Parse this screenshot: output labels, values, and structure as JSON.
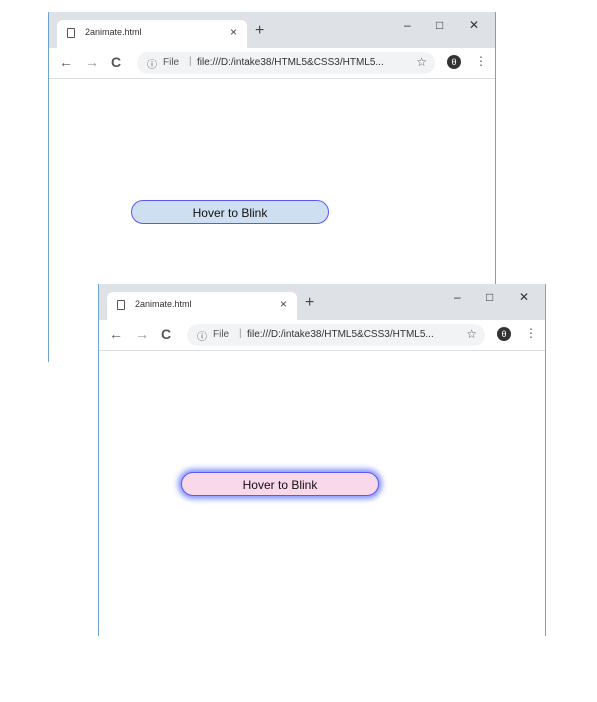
{
  "windows": [
    {
      "tab_title": "2animate.html",
      "tab_close": "×",
      "new_tab": "+",
      "minimize": "–",
      "maximize": "□",
      "close": "✕",
      "back": "←",
      "forward": "→",
      "reload": "C",
      "info_icon": "ⓘ",
      "scheme_label": "File",
      "separator": "|",
      "url": "file:///D:/intake38/HTML5&CSS3/HTML5...",
      "bookmark": "☆",
      "account": "θ",
      "menu": "⋮",
      "button_label": "Hover to Blink",
      "button_color": "#cddff0"
    },
    {
      "tab_title": "2animate.html",
      "tab_close": "×",
      "new_tab": "+",
      "minimize": "–",
      "maximize": "□",
      "close": "✕",
      "back": "←",
      "forward": "→",
      "reload": "C",
      "info_icon": "ⓘ",
      "scheme_label": "File",
      "separator": "|",
      "url": "file:///D:/intake38/HTML5&CSS3/HTML5...",
      "bookmark": "☆",
      "account": "θ",
      "menu": "⋮",
      "button_label": "Hover to Blink",
      "button_color": "#f9d8ea",
      "glow_color": "#5a6eff"
    }
  ]
}
